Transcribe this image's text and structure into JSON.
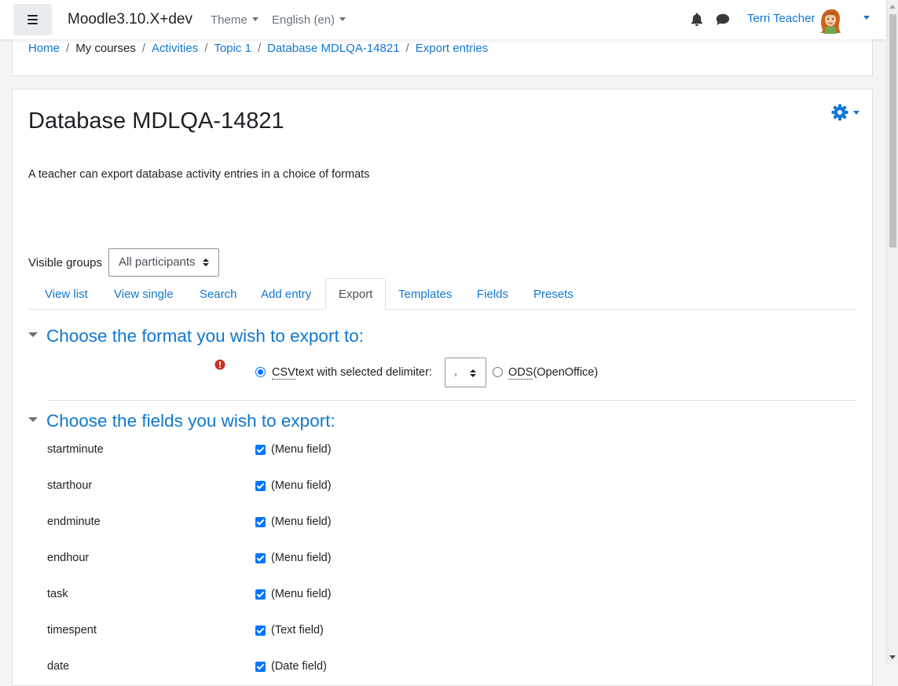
{
  "navbar": {
    "brand": "Moodle3.10.X+dev",
    "theme_label": "Theme",
    "language_label": "English ‎(en)‎",
    "user_name": "Terri Teacher"
  },
  "breadcrumb": {
    "items": [
      "Home",
      "My courses",
      "Activities",
      "Topic 1",
      "Database MDLQA-14821",
      "Export entries"
    ]
  },
  "page": {
    "title": "Database MDLQA-14821",
    "intro": "A teacher can export database activity entries in a choice of formats"
  },
  "groups": {
    "label": "Visible groups",
    "selected": "All participants"
  },
  "tabs": [
    "View list",
    "View single",
    "Search",
    "Add entry",
    "Export",
    "Templates",
    "Fields",
    "Presets"
  ],
  "active_tab": "Export",
  "format_section": {
    "heading": "Choose the format you wish to export to:",
    "csv_abbr": "CSV",
    "csv_label": "text with selected delimiter:",
    "delimiter": ",",
    "ods_abbr": "ODS",
    "ods_label": "(OpenOffice)",
    "selected": "csv"
  },
  "fields_section": {
    "heading": "Choose the fields you wish to export:",
    "fields": [
      {
        "name": "startminute",
        "type": "(Menu field)",
        "checked": true
      },
      {
        "name": "starthour",
        "type": "(Menu field)",
        "checked": true
      },
      {
        "name": "endminute",
        "type": "(Menu field)",
        "checked": true
      },
      {
        "name": "endhour",
        "type": "(Menu field)",
        "checked": true
      },
      {
        "name": "task",
        "type": "(Menu field)",
        "checked": true
      },
      {
        "name": "timespent",
        "type": "(Text field)",
        "checked": true
      },
      {
        "name": "date",
        "type": "(Date field)",
        "checked": true
      }
    ]
  },
  "colors": {
    "link": "#1177d1",
    "text": "#1d2125",
    "checkbox": "#0075ff",
    "required": "#ca3120"
  }
}
